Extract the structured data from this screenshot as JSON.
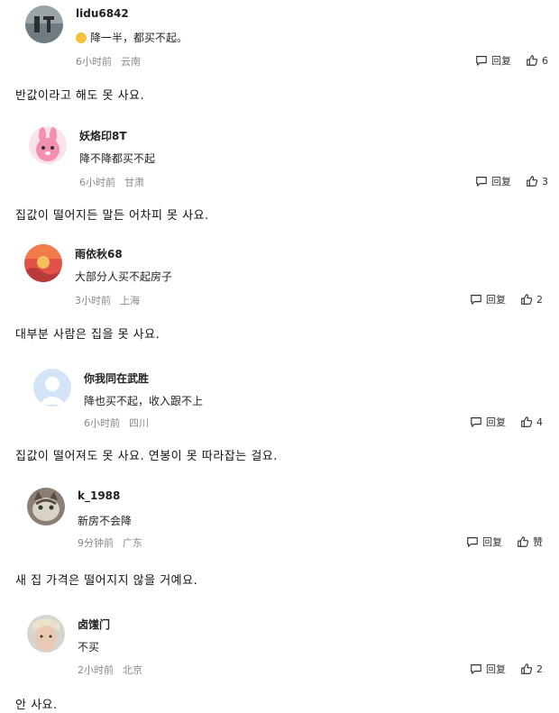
{
  "comments": [
    {
      "username": "lidu6842",
      "text": "降一半，都买不起。",
      "time": "6小时前",
      "location": "云南",
      "reply_label": "回复",
      "likes": "6",
      "translation": "반값이라고 해도 못 사요."
    },
    {
      "username": "妖烙印8T",
      "text": "降不降都买不起",
      "time": "6小时前",
      "location": "甘肃",
      "reply_label": "回复",
      "likes": "3",
      "translation": "집값이 떨어지든 말든 어차피 못 사요."
    },
    {
      "username": "雨依秋68",
      "text": "大部分人买不起房子",
      "time": "3小时前",
      "location": "上海",
      "reply_label": "回复",
      "likes": "2",
      "translation": "대부분 사람은 집을 못 사요."
    },
    {
      "username": "你我同在武胜",
      "text": "降也买不起，收入跟不上",
      "time": "6小时前",
      "location": "四川",
      "reply_label": "回复",
      "likes": "4",
      "translation": "집값이 떨어져도 못 사요. 연봉이 못 따라잡는 걸요."
    },
    {
      "username": "k_1988",
      "text": "新房不会降",
      "time": "9分钟前",
      "location": "广东",
      "reply_label": "回复",
      "likes": "赞",
      "translation": "새 집 가격은 떨어지지 않을 거예요."
    },
    {
      "username": "卤馐门",
      "text": "不买",
      "time": "2小时前",
      "location": "北京",
      "reply_label": "回复",
      "likes": "2",
      "translation": "안 사요."
    }
  ],
  "colors": {
    "meta": "#888888",
    "text": "#222222"
  },
  "icons": {
    "reply": "comment-bubble-icon",
    "like": "thumbs-up-icon",
    "emoji": "laughing-emoji-icon"
  }
}
